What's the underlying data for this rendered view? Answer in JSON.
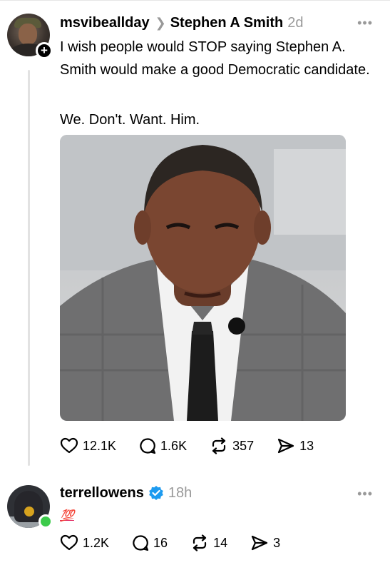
{
  "post1": {
    "username": "msvibeallday",
    "reply_to": "Stephen A Smith",
    "time": "2d",
    "text": "I wish people would STOP saying Stephen A. Smith would make a good Democratic candidate.",
    "text2": "We. Don't. Want. Him.",
    "stats": {
      "likes": "12.1K",
      "replies": "1.6K",
      "reposts": "357",
      "shares": "13"
    }
  },
  "post2": {
    "username": "terrellowens",
    "time": "18h",
    "text": "💯",
    "stats": {
      "likes": "1.2K",
      "replies": "16",
      "reposts": "14",
      "shares": "3"
    }
  },
  "icons": {
    "follow": "plus-icon",
    "more": "more-horizontal-icon",
    "like": "heart-icon",
    "reply": "comment-icon",
    "repost": "repost-icon",
    "share": "send-icon",
    "verified": "verified-badge-icon"
  },
  "colors": {
    "verified": "#1d9bf0",
    "online": "#3ccb4b",
    "muted": "#999999"
  }
}
